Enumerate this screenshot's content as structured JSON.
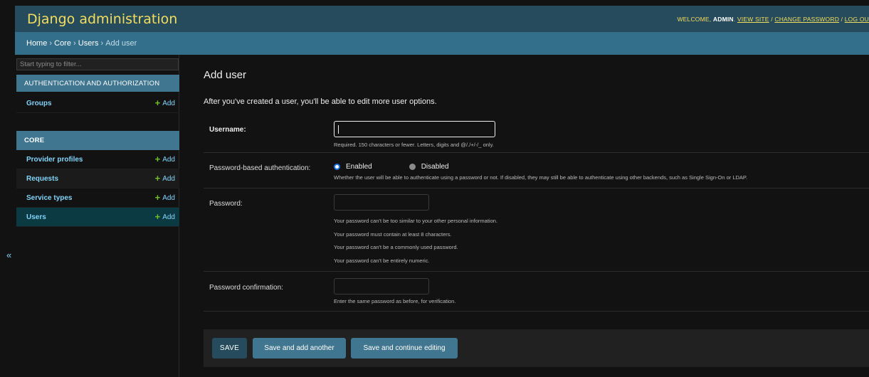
{
  "header": {
    "brand": "Django administration",
    "welcome": "WELCOME,",
    "username": "ADMIN",
    "view_site": "VIEW SITE",
    "change_password": "CHANGE PASSWORD",
    "log_out": "LOG OU",
    "sep": " / "
  },
  "breadcrumbs": {
    "home": "Home",
    "core": "Core",
    "users": "Users",
    "current": "Add user",
    "sep": " › "
  },
  "sidebar": {
    "filter_placeholder": "Start typing to filter...",
    "auth_caption": "AUTHENTICATION AND AUTHORIZATION",
    "core_caption": "CORE",
    "add_label": "Add",
    "auth_items": [
      {
        "label": "Groups"
      }
    ],
    "core_items": [
      {
        "label": "Provider profiles"
      },
      {
        "label": "Requests"
      },
      {
        "label": "Service types"
      },
      {
        "label": "Users"
      }
    ],
    "collapse_icon": "«"
  },
  "content": {
    "title": "Add user",
    "intro": "After you've created a user, you'll be able to edit more user options.",
    "username": {
      "label": "Username:",
      "value": "",
      "help": "Required. 150 characters or fewer. Letters, digits and @/./+/-/_ only."
    },
    "auth": {
      "label": "Password-based authentication:",
      "enabled": "Enabled",
      "disabled": "Disabled",
      "selected": "Enabled",
      "help": "Whether the user will be able to authenticate using a password or not. If disabled, they may still be able to authenticate using other backends, such as Single Sign-On or LDAP."
    },
    "password": {
      "label": "Password:",
      "value": "",
      "help": [
        "Your password can't be too similar to your other personal information.",
        "Your password must contain at least 8 characters.",
        "Your password can't be a commonly used password.",
        "Your password can't be entirely numeric."
      ]
    },
    "password_confirm": {
      "label": "Password confirmation:",
      "value": "",
      "help": "Enter the same password as before, for verification."
    }
  },
  "submit": {
    "save": "SAVE",
    "save_add_another": "Save and add another",
    "save_continue": "Save and continue editing"
  },
  "colors": {
    "header_bg": "#264b5d",
    "breadcrumb_bg": "#336f8a",
    "caption_bg": "#417690",
    "brand": "#f5dd5d",
    "link": "#81d4fa",
    "add_plus": "#70bf2b",
    "selected_row": "#0c3a42"
  }
}
